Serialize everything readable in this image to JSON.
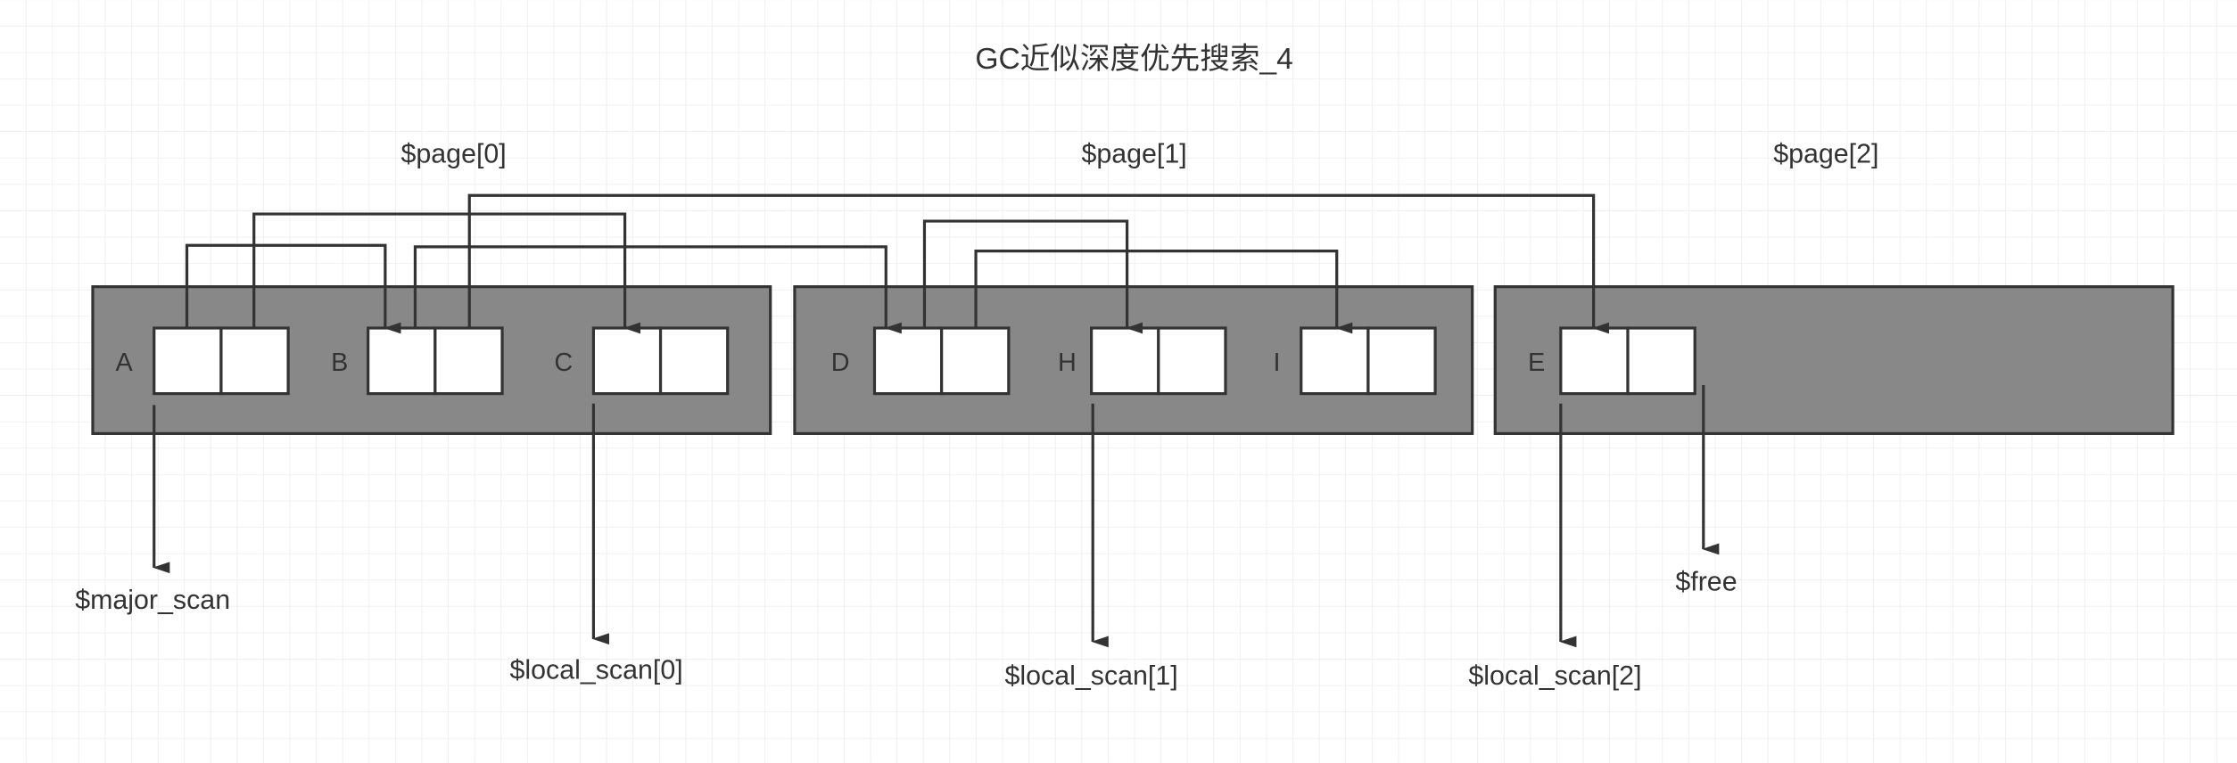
{
  "title": "GC近似深度优先搜索_4",
  "pages": [
    {
      "label": "$page[0]",
      "objects": [
        "A",
        "B",
        "C"
      ]
    },
    {
      "label": "$page[1]",
      "objects": [
        "D",
        "H",
        "I"
      ]
    },
    {
      "label": "$page[2]",
      "objects": [
        "E"
      ]
    }
  ],
  "pointers": [
    {
      "from": "A",
      "slot": 0,
      "to": "B"
    },
    {
      "from": "A",
      "slot": 1,
      "to": "C"
    },
    {
      "from": "B",
      "slot": 0,
      "to": "D"
    },
    {
      "from": "B",
      "slot": 1,
      "to": "E"
    },
    {
      "from": "D",
      "slot": 0,
      "to": "H"
    },
    {
      "from": "D",
      "slot": 1,
      "to": "I"
    }
  ],
  "scan_pointers": [
    {
      "label": "$major_scan",
      "target": "A"
    },
    {
      "label": "$local_scan[0]",
      "target": "C"
    },
    {
      "label": "$local_scan[1]",
      "target": "H"
    },
    {
      "label": "$local_scan[2]",
      "target": "E"
    },
    {
      "label": "$free",
      "target": "after-E"
    }
  ],
  "colors": {
    "page_fill": "#888888",
    "stroke": "#333333",
    "cell_fill": "#ffffff",
    "grid": "#e6e6e6"
  }
}
